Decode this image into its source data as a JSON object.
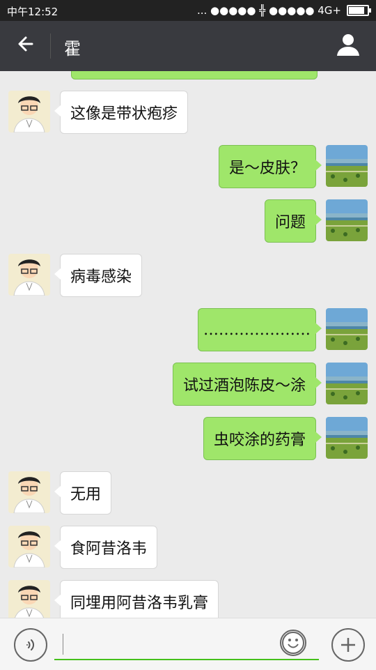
{
  "status_bar": {
    "time": "中午12:52",
    "signal_text": "... ●●●●● ╬ ●●●●● 4G+",
    "battery_level": 0.85
  },
  "header": {
    "title": "霍",
    "back_icon": "arrow-left-icon",
    "profile_icon": "person-icon"
  },
  "messages": [
    {
      "side": "left",
      "text": "这像是带状疱疹",
      "avatar": "doctor-avatar"
    },
    {
      "side": "right",
      "text": "是～皮肤？",
      "avatar": "landscape-avatar"
    },
    {
      "side": "right",
      "text": "问题",
      "avatar": "landscape-avatar"
    },
    {
      "side": "left",
      "text": "病毒感染",
      "avatar": "doctor-avatar"
    },
    {
      "side": "right",
      "text": "…………………",
      "avatar": "landscape-avatar"
    },
    {
      "side": "right",
      "text": "试过酒泡陈皮～涂",
      "avatar": "landscape-avatar"
    },
    {
      "side": "right",
      "text": "虫咬涂的药膏",
      "avatar": "landscape-avatar"
    },
    {
      "side": "left",
      "text": "无用",
      "avatar": "doctor-avatar"
    },
    {
      "side": "left",
      "text": "食阿昔洛韦",
      "avatar": "doctor-avatar"
    },
    {
      "side": "left",
      "text": "同埋用阿昔洛韦乳膏",
      "avatar": "doctor-avatar"
    }
  ],
  "composer": {
    "voice_icon": "voice-icon",
    "emoji_icon": "emoji-icon",
    "plus_icon": "plus-icon",
    "input_value": ""
  },
  "colors": {
    "header_bg": "#393a3f",
    "sent_bubble": "#9fe66a",
    "received_bubble": "#ffffff",
    "input_accent": "#45c01a"
  }
}
